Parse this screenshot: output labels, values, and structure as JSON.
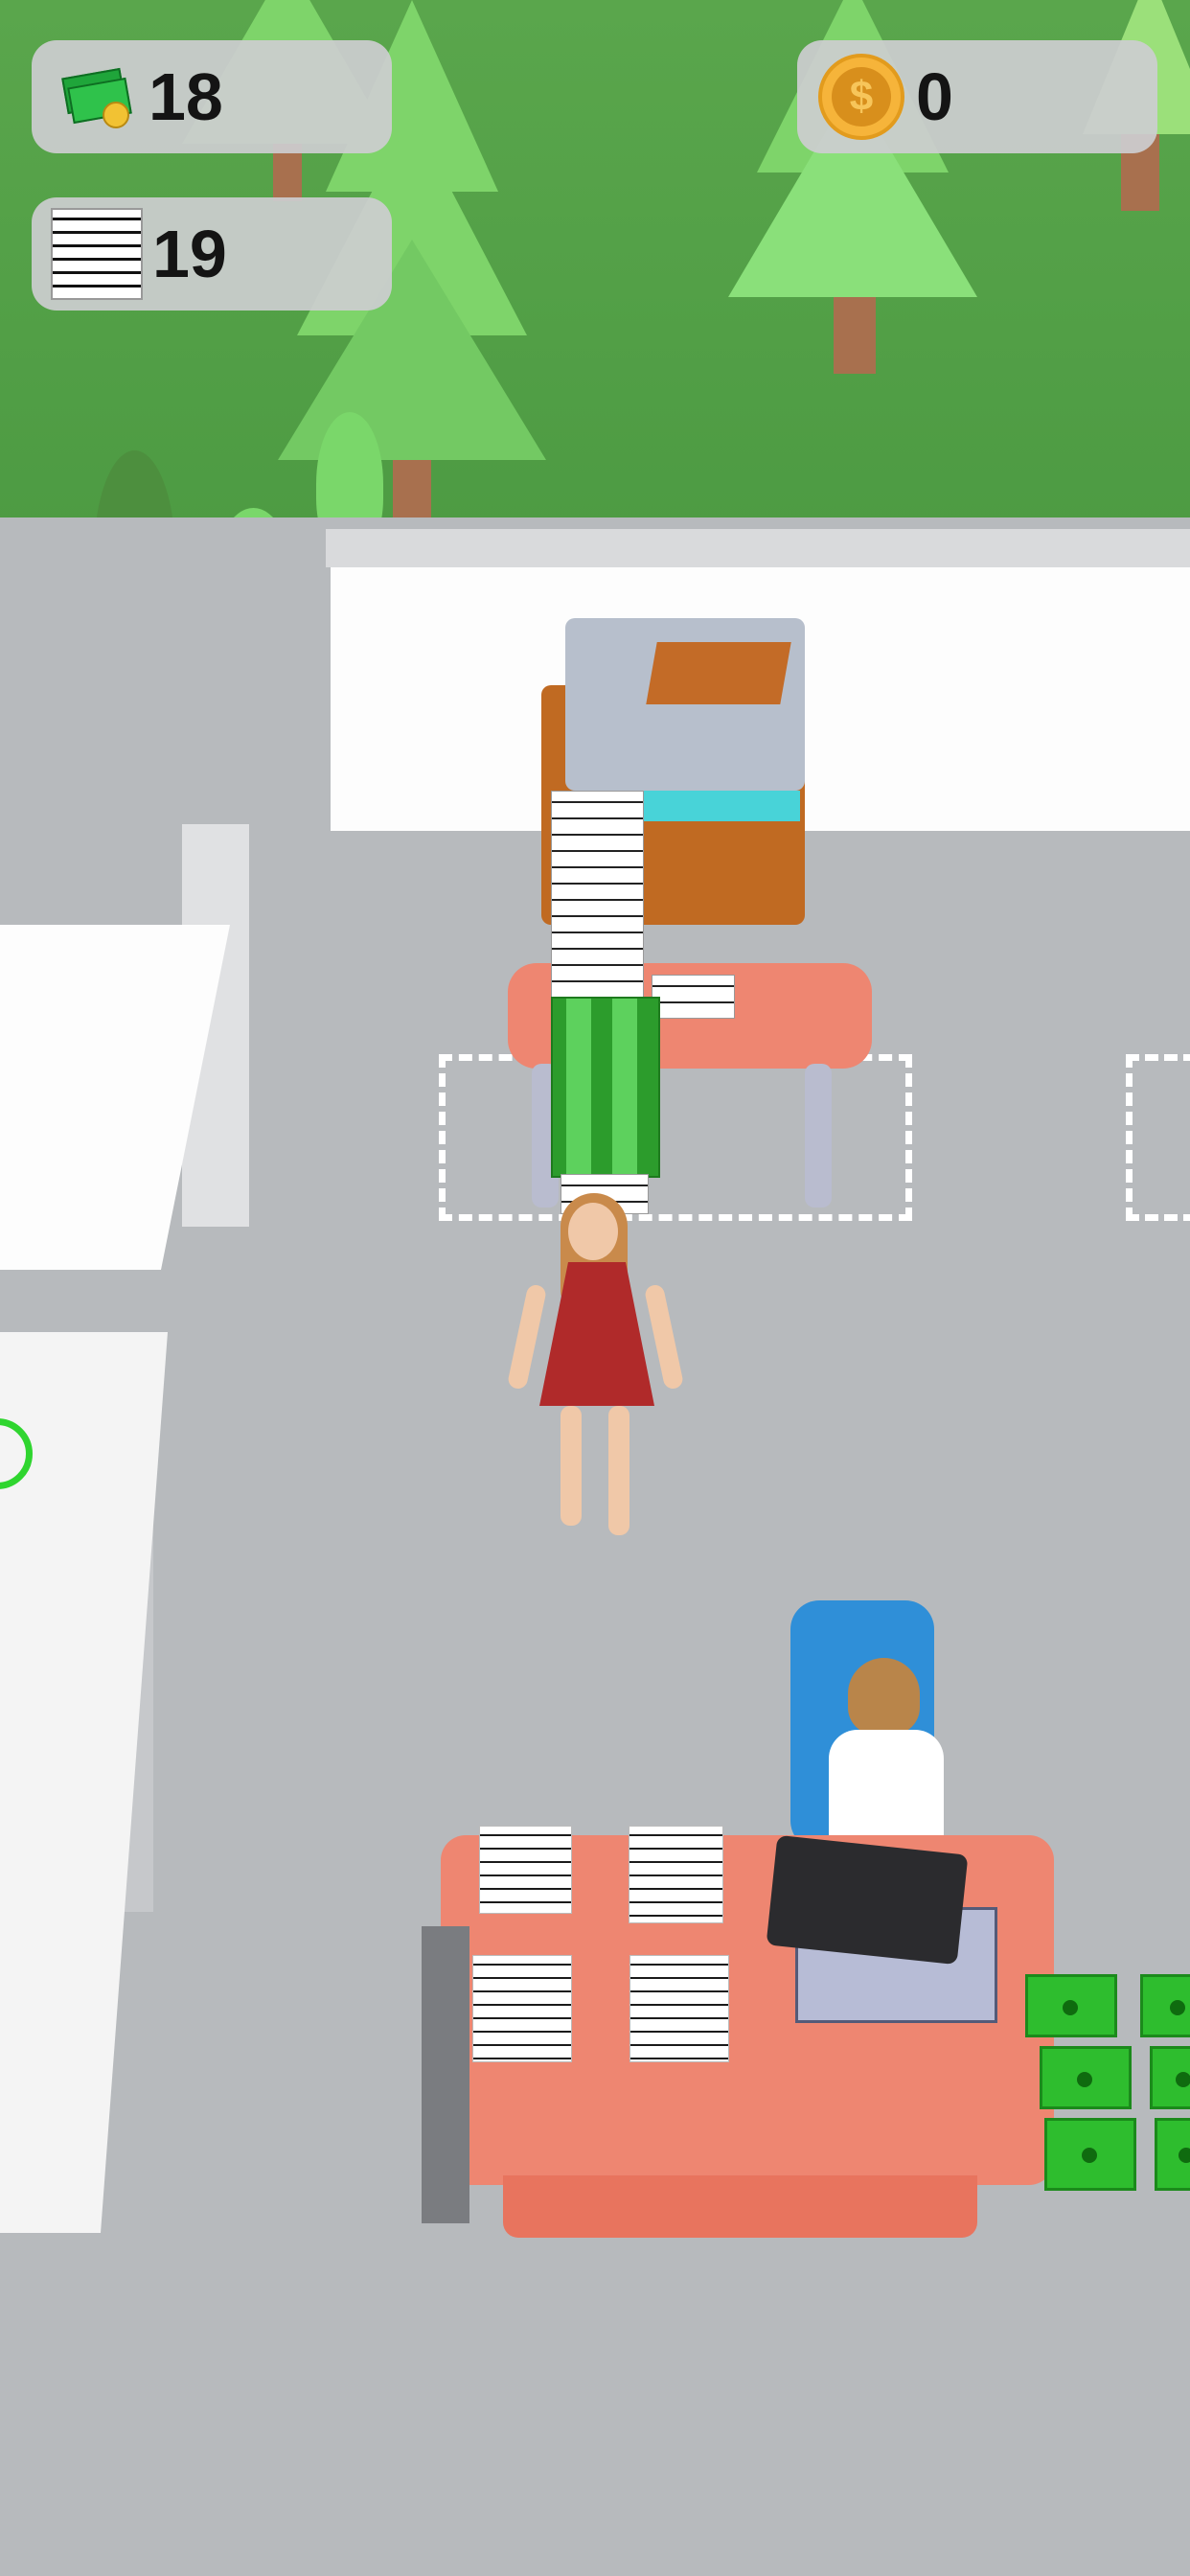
{
  "hud": {
    "money": {
      "icon": "cash-bills-icon",
      "value": "18"
    },
    "paper": {
      "icon": "paper-stack-icon",
      "value": "19"
    },
    "coins": {
      "icon": "dollar-coin-icon",
      "value": "0"
    }
  },
  "colors": {
    "grass": "#4f9a45",
    "floor": "#b7babd",
    "hud_bg": "#cdcdd0",
    "coin": "#e0a030",
    "money": "#2ebd2e",
    "desk": "#ee8671",
    "player_dress": "#b02a2a"
  }
}
